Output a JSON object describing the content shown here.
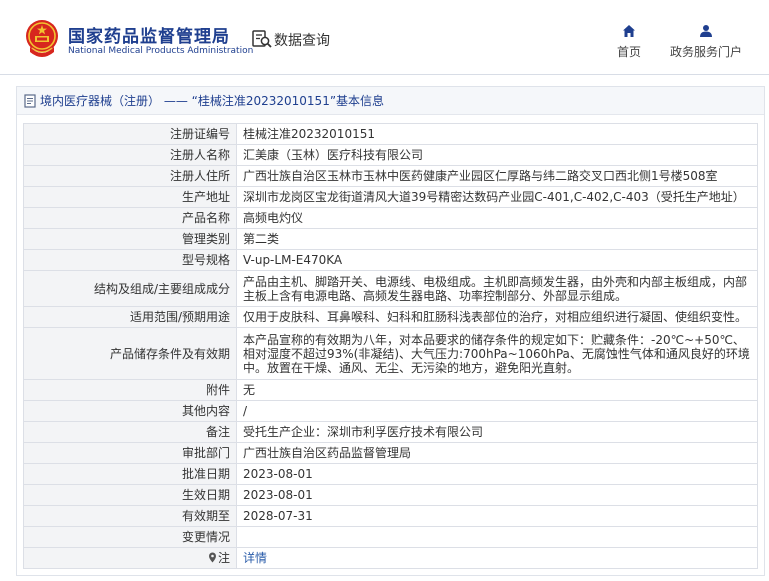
{
  "header": {
    "brand_cn": "国家药品监督管理局",
    "brand_en": "National Medical Products Administration",
    "query_label": "数据查询",
    "nav": {
      "home": "首页",
      "service": "政务服务门户"
    }
  },
  "panel": {
    "title": "境内医疗器械（注册） —— “桂械注准20232010151”基本信息"
  },
  "rows": [
    {
      "label": "注册证编号",
      "value": "桂械注准20232010151"
    },
    {
      "label": "注册人名称",
      "value": "汇美康（玉林）医疗科技有限公司"
    },
    {
      "label": "注册人住所",
      "value": "广西壮族自治区玉林市玉林中医药健康产业园区仁厚路与纬二路交叉口西北侧1号楼508室"
    },
    {
      "label": "生产地址",
      "value": "深圳市龙岗区宝龙街道清风大道39号精密达数码产业园C-401,C-402,C-403（受托生产地址）"
    },
    {
      "label": "产品名称",
      "value": "高频电灼仪"
    },
    {
      "label": "管理类别",
      "value": "第二类"
    },
    {
      "label": "型号规格",
      "value": "V-up-LM-E470KA"
    },
    {
      "label": "结构及组成/主要组成成分",
      "value": "产品由主机、脚踏开关、电源线、电极组成。主机即高频发生器，由外壳和内部主板组成，内部主板上含有电源电路、高频发生器电路、功率控制部分、外部显示组成。"
    },
    {
      "label": "适用范围/预期用途",
      "value": "仅用于皮肤科、耳鼻喉科、妇科和肛肠科浅表部位的治疗，对相应组织进行凝固、使组织变性。"
    },
    {
      "label": "产品储存条件及有效期",
      "value": "本产品宣称的有效期为八年，对本品要求的储存条件的规定如下：贮藏条件：-20℃~+50℃、相对湿度不超过93%(非凝结)、大气压力:700hPa~1060hPa、无腐蚀性气体和通风良好的环境中。放置在干燥、通风、无尘、无污染的地方，避免阳光直射。"
    },
    {
      "label": "附件",
      "value": "无"
    },
    {
      "label": "其他内容",
      "value": "/"
    },
    {
      "label": "备注",
      "value": "受托生产企业：深圳市利孚医疗技术有限公司"
    },
    {
      "label": "审批部门",
      "value": "广西壮族自治区药品监督管理局"
    },
    {
      "label": "批准日期",
      "value": "2023-08-01"
    },
    {
      "label": "生效日期",
      "value": "2023-08-01"
    },
    {
      "label": "有效期至",
      "value": "2028-07-31"
    },
    {
      "label": "变更情况",
      "value": ""
    },
    {
      "label": "注",
      "value": "详情"
    }
  ],
  "colors": {
    "brand_blue": "#1f3f8f",
    "emblem_red": "#d7261e",
    "emblem_gold": "#f2c230",
    "link_blue": "#2a5caa",
    "label_bg": "#f3f4f6",
    "border": "#dcdfe6"
  },
  "icons": {
    "emblem": "national-emblem",
    "query": "data-query-icon",
    "home": "home-icon",
    "service": "user-service-icon",
    "title": "document-icon",
    "note": "pin-icon"
  }
}
